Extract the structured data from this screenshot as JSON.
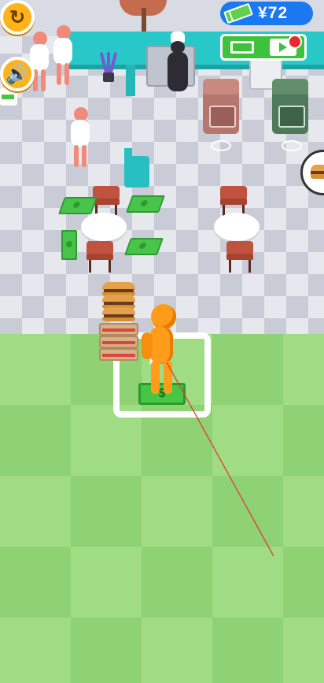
{
  "hud": {
    "restart_icon": "restart-icon",
    "sound_icon": "sound-icon",
    "currency_symbol": "¥",
    "money_amount": "72",
    "ad_bonus_icon": "video-ad-icon"
  },
  "station": {
    "order_pad_count": "7",
    "cash_symbol": "$"
  },
  "scene": {
    "order_bubble_icon": "burger-icon",
    "colors": {
      "floor_light": "#e6e8ee",
      "floor_dark": "#c9ccd6",
      "grass": "#9fdc83",
      "counter": "#29c8c8",
      "player": "#ff9c19",
      "money_pill": "#1b78f0",
      "ad_button": "#3ec13b"
    }
  }
}
